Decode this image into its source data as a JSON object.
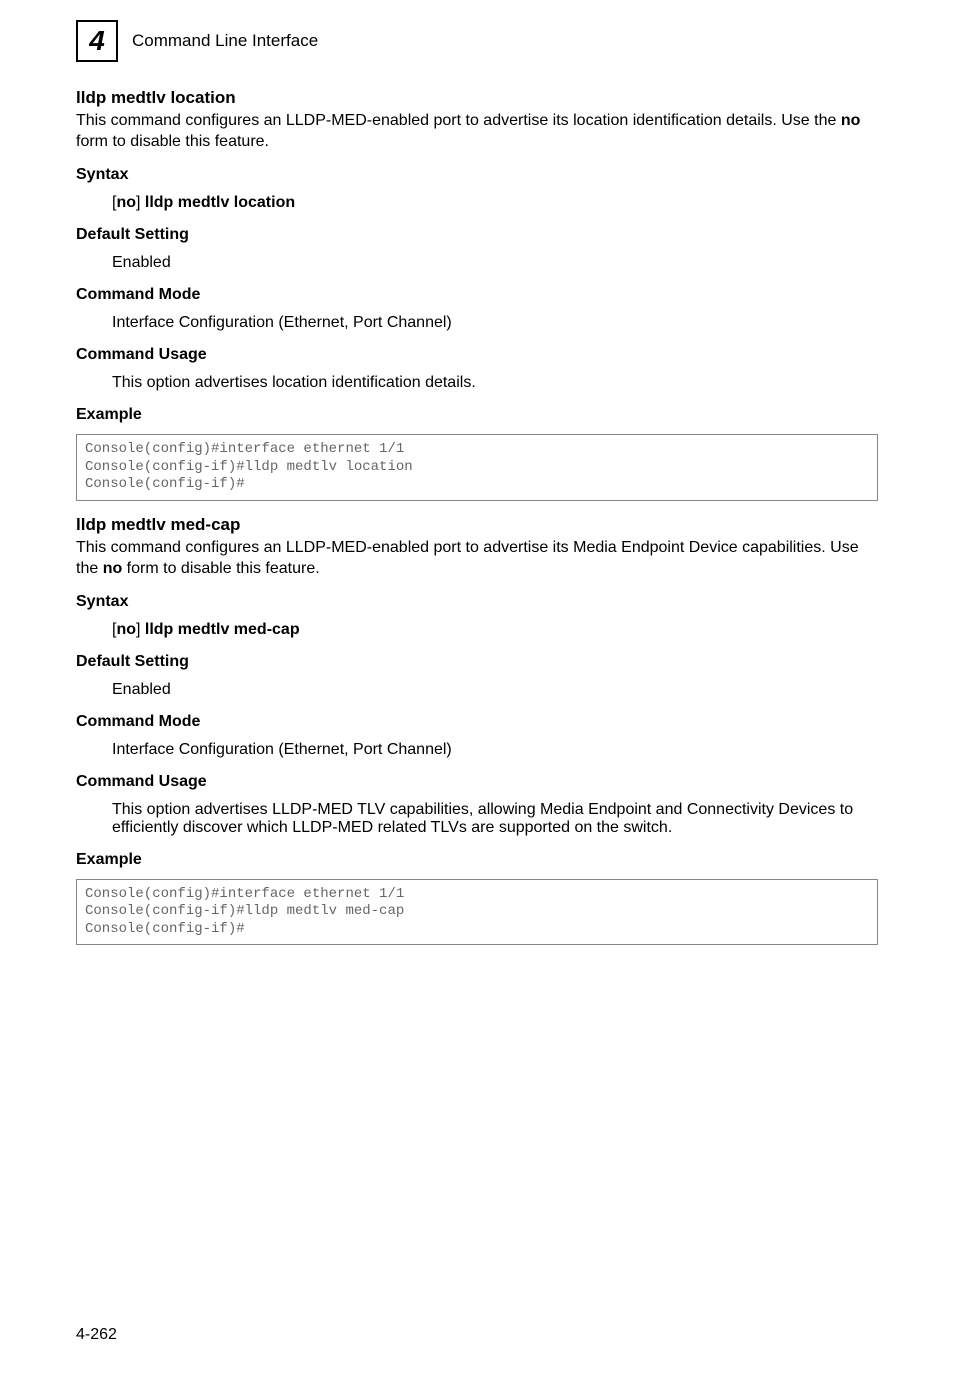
{
  "header": {
    "chapter_number": "4",
    "chapter_title": "Command Line Interface"
  },
  "cmd1": {
    "name": "lldp medtlv location",
    "desc_pre": "This command configures an LLDP-MED-enabled port to advertise its location identification details. Use the ",
    "desc_bold": "no",
    "desc_post": " form to disable this feature.",
    "syntax_label": "Syntax",
    "syntax_open": "[",
    "syntax_no": "no",
    "syntax_mid": "] ",
    "syntax_cmd": "lldp medtlv location",
    "default_label": "Default Setting",
    "default_value": "Enabled",
    "mode_label": "Command Mode",
    "mode_value": "Interface Configuration (Ethernet, Port Channel)",
    "usage_label": "Command Usage",
    "usage_value": "This option advertises location identification details.",
    "example_label": "Example",
    "example_code": "Console(config)#interface ethernet 1/1\nConsole(config-if)#lldp medtlv location\nConsole(config-if)#"
  },
  "cmd2": {
    "name": "lldp medtlv med-cap",
    "desc_pre": "This command configures an LLDP-MED-enabled port to advertise its Media Endpoint Device capabilities. Use the ",
    "desc_bold": "no",
    "desc_post": " form to disable this feature.",
    "syntax_label": "Syntax",
    "syntax_open": "[",
    "syntax_no": "no",
    "syntax_mid": "] ",
    "syntax_cmd": "lldp medtlv med-cap",
    "default_label": "Default Setting",
    "default_value": "Enabled",
    "mode_label": "Command Mode",
    "mode_value": "Interface Configuration (Ethernet, Port Channel)",
    "usage_label": "Command Usage",
    "usage_value": "This option advertises LLDP-MED TLV capabilities, allowing Media Endpoint and Connectivity Devices to efficiently discover which LLDP-MED related TLVs are supported on the switch.",
    "example_label": "Example",
    "example_code": "Console(config)#interface ethernet 1/1\nConsole(config-if)#lldp medtlv med-cap\nConsole(config-if)#"
  },
  "footer": {
    "page_number": "4-262"
  }
}
